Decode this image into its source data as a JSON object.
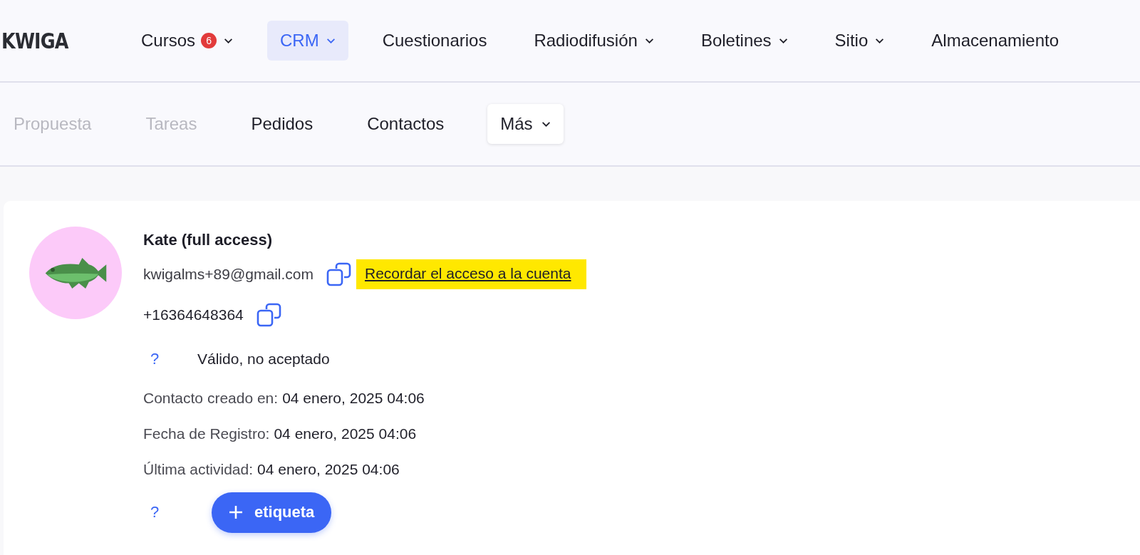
{
  "logo": "KWIGA",
  "nav": [
    {
      "label": "Cursos",
      "badge": "6",
      "dropdown": true,
      "selected": false
    },
    {
      "label": "CRM",
      "dropdown": true,
      "selected": true
    },
    {
      "label": "Cuestionarios",
      "dropdown": false,
      "selected": false
    },
    {
      "label": "Radiodifusión",
      "dropdown": true,
      "selected": false
    },
    {
      "label": "Boletines",
      "dropdown": true,
      "selected": false
    },
    {
      "label": "Sitio",
      "dropdown": true,
      "selected": false
    },
    {
      "label": "Almacenamiento",
      "dropdown": false,
      "selected": false
    }
  ],
  "subnav": [
    {
      "label": "Propuesta",
      "disabled": true,
      "kind": "link"
    },
    {
      "label": "Tareas",
      "disabled": true,
      "kind": "link"
    },
    {
      "label": "Pedidos",
      "disabled": false,
      "kind": "link"
    },
    {
      "label": "Contactos",
      "disabled": false,
      "kind": "link"
    },
    {
      "label": "Más",
      "disabled": false,
      "kind": "menu"
    }
  ],
  "contact": {
    "name": "Kate (full access)",
    "email": "kwigalms+89@gmail.com",
    "access_link": {
      "label": "Recordar el acceso a la cuenta",
      "highlighted": true
    },
    "phone": "+16364648364",
    "status_icon": "?",
    "status": "Válido, no aceptado",
    "details": [
      {
        "label": "Contacto creado en:",
        "value": "04 enero, 2025 04:06"
      },
      {
        "label": "Fecha de Registro:",
        "value": "04 enero, 2025 04:06"
      },
      {
        "label": "Última actividad:",
        "value": "04 enero, 2025 04:06"
      }
    ],
    "tags_icon": "?",
    "tag_button": "etiqueta"
  }
}
